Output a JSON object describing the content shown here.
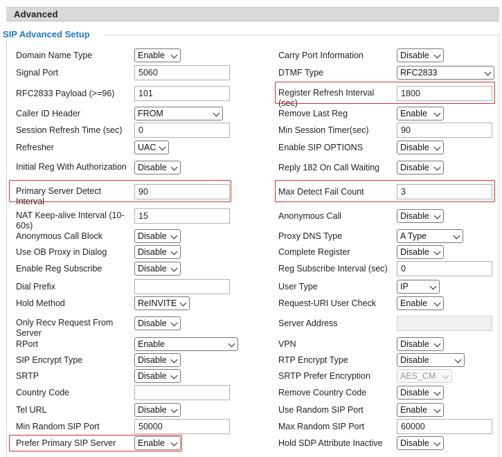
{
  "header": {
    "title": "Advanced"
  },
  "section": {
    "title": "SIP Advanced Setup"
  },
  "rows": [
    {
      "left": {
        "label": "Domain Name Type",
        "type": "select",
        "value": "Enable"
      },
      "right": {
        "label": "Carry Port Information",
        "type": "select",
        "value": "Disable"
      }
    },
    {
      "left": {
        "label": "Signal Port",
        "type": "input",
        "value": "5060"
      },
      "right": {
        "label": "DTMF Type",
        "type": "select",
        "value": "RFC2833"
      }
    },
    {
      "left": {
        "label": "RFC2833 Payload (>=96)",
        "type": "input",
        "value": "101"
      },
      "right": {
        "label": "Register Refresh Interval (sec)",
        "type": "input",
        "value": "1800",
        "highlighted": true
      }
    },
    {
      "left": {
        "label": "Caller ID Header",
        "type": "select",
        "value": "FROM"
      },
      "right": {
        "label": "Remove Last Reg",
        "type": "select",
        "value": "Enable"
      }
    },
    {
      "left": {
        "label": "Session Refresh Time (sec)",
        "type": "input",
        "value": "0"
      },
      "right": {
        "label": "Min Session Timer(sec)",
        "type": "input",
        "value": "90"
      }
    },
    {
      "left": {
        "label": "Refresher",
        "type": "select",
        "value": "UAC"
      },
      "right": {
        "label": "Enable SIP OPTIONS",
        "type": "select",
        "value": "Disable"
      }
    },
    {
      "left": {
        "label": "Initial Reg With Authorization",
        "type": "select",
        "value": "Disable"
      },
      "right": {
        "label": "Reply 182 On Call Waiting",
        "type": "select",
        "value": "Disable"
      }
    },
    {
      "left": {
        "label": "Primary Server Detect Interval",
        "type": "input",
        "value": "90",
        "highlighted": true
      },
      "right": {
        "label": "Max Detect Fail Count",
        "type": "input",
        "value": "3",
        "highlighted": true
      }
    },
    {
      "left": {
        "label": "NAT Keep-alive Interval (10-60s)",
        "type": "input",
        "value": "15"
      },
      "right": {
        "label": "Anonymous Call",
        "type": "select",
        "value": "Disable"
      }
    },
    {
      "left": {
        "label": "Anonymous Call Block",
        "type": "select",
        "value": "Disable"
      },
      "right": {
        "label": "Proxy DNS Type",
        "type": "select",
        "value": "A Type"
      }
    },
    {
      "left": {
        "label": "Use OB Proxy in Dialog",
        "type": "select",
        "value": "Disable"
      },
      "right": {
        "label": "Complete Register",
        "type": "select",
        "value": "Disable"
      }
    },
    {
      "left": {
        "label": "Enable Reg Subscribe",
        "type": "select",
        "value": "Disable"
      },
      "right": {
        "label": "Reg Subscribe Interval (sec)",
        "type": "input",
        "value": "0"
      }
    },
    {
      "left": {
        "label": "Dial Prefix",
        "type": "input",
        "value": ""
      },
      "right": {
        "label": "User Type",
        "type": "select",
        "value": "IP"
      }
    },
    {
      "left": {
        "label": "Hold Method",
        "type": "select",
        "value": "ReINVITE"
      },
      "right": {
        "label": "Request-URI User Check",
        "type": "select",
        "value": "Enable"
      }
    },
    {
      "left": {
        "label": "Only Recv Request From Server",
        "type": "select",
        "value": "Disable"
      },
      "right": {
        "label": "Server Address",
        "type": "input",
        "value": "",
        "disabled": true
      }
    },
    {
      "left": {
        "label": "RPort",
        "type": "select",
        "value": "Enable"
      },
      "right": {
        "label": "VPN",
        "type": "select",
        "value": "Disable"
      }
    },
    {
      "left": {
        "label": "SIP Encrypt Type",
        "type": "select",
        "value": "Disable"
      },
      "right": {
        "label": "RTP Encrypt Type",
        "type": "select",
        "value": "Disable"
      }
    },
    {
      "left": {
        "label": "SRTP",
        "type": "select",
        "value": "Disable"
      },
      "right": {
        "label": "SRTP Prefer Encryption",
        "type": "select",
        "value": "AES_CM",
        "disabled": true
      }
    },
    {
      "left": {
        "label": "Country Code",
        "type": "input",
        "value": ""
      },
      "right": {
        "label": "Remove Country Code",
        "type": "select",
        "value": "Disable"
      }
    },
    {
      "left": {
        "label": "Tel URL",
        "type": "select",
        "value": "Disable"
      },
      "right": {
        "label": "Use Random SIP Port",
        "type": "select",
        "value": "Enable"
      }
    },
    {
      "left": {
        "label": "Min Random SIP Port",
        "type": "input",
        "value": "50000"
      },
      "right": {
        "label": "Max Random SIP Port",
        "type": "input",
        "value": "60000"
      }
    },
    {
      "left": {
        "label": "Prefer Primary SIP Server",
        "type": "select",
        "value": "Enable",
        "highlighted": true
      },
      "right": {
        "label": "Hold SDP Attribute Inactive",
        "type": "select",
        "value": "Disable"
      }
    }
  ]
}
